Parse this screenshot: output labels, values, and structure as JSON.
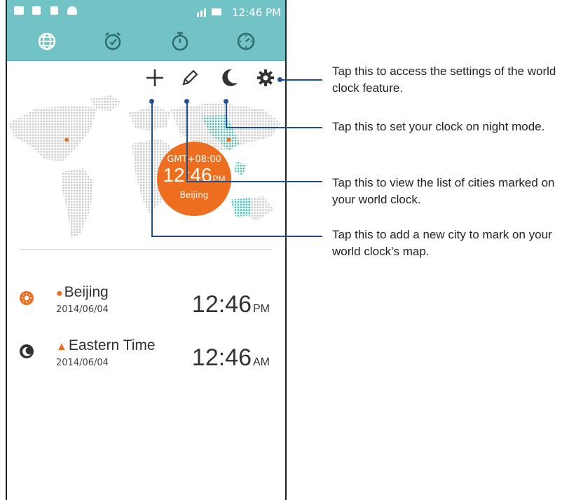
{
  "status_bar": {
    "time": "12:46 PM",
    "notification_icons": [
      "image-icon",
      "clipboard-icon",
      "sd-card-icon",
      "android-icon"
    ]
  },
  "nav_tabs": [
    {
      "name": "world-clock",
      "icon": "globe-icon"
    },
    {
      "name": "alarm",
      "icon": "alarm-clock-icon"
    },
    {
      "name": "stopwatch",
      "icon": "stopwatch-icon"
    },
    {
      "name": "timer",
      "icon": "timer-icon"
    }
  ],
  "toolbar": [
    {
      "icon": "plus-icon"
    },
    {
      "icon": "pencil-icon"
    },
    {
      "icon": "moon-icon"
    },
    {
      "icon": "gear-icon"
    }
  ],
  "map_clock": {
    "gmt": "GMT+08:00",
    "time": "12:46",
    "ampm": "PM",
    "city": "Beijing"
  },
  "cities": [
    {
      "name": "Beijing",
      "date": "2014/06/04",
      "time": "12:46",
      "ampm": "PM",
      "marker": "location-pin-icon",
      "daynight": "sun-icon"
    },
    {
      "name": "Eastern Time",
      "date": "2014/06/04",
      "time": "12:46",
      "ampm": "AM",
      "marker": "home-icon",
      "daynight": "moon-icon"
    }
  ],
  "callouts": [
    {
      "text": "Tap this to access the settings of the world clock feature."
    },
    {
      "text": "Tap this to set your clock on night mode."
    },
    {
      "text": "Tap this to view the list of cities marked on your world clock."
    },
    {
      "text": "Tap this to add a new city to mark on your world clock’s map."
    }
  ],
  "colors": {
    "header": "#72c3c6",
    "accent": "#ed6e1f",
    "callout_line": "#1f4f8f",
    "map_dot": "#c8c8c8",
    "map_highlight": "#3dbfb3"
  }
}
